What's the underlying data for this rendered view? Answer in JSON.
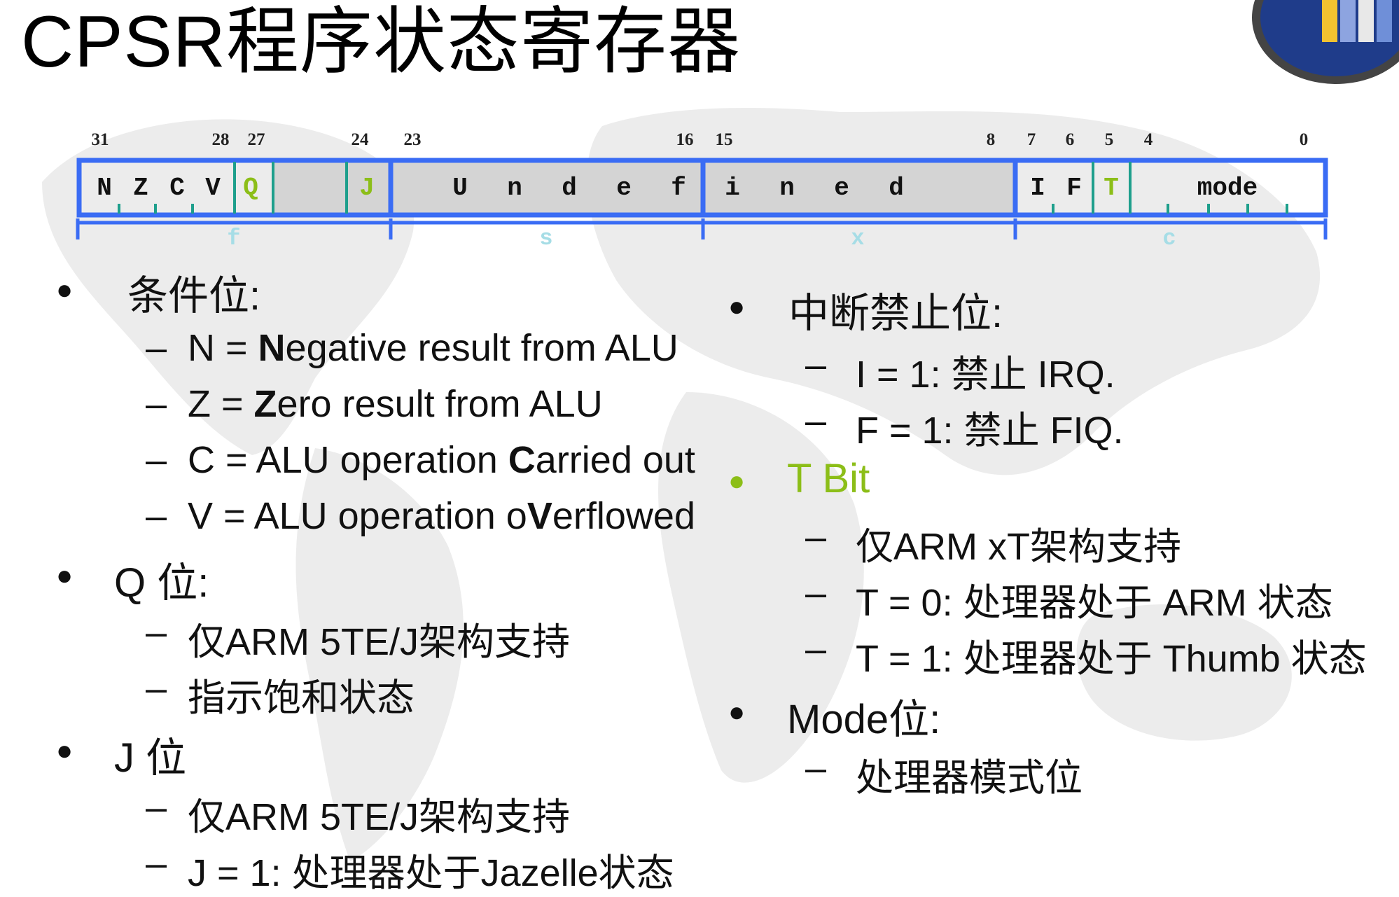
{
  "title": "CPSR程序状态寄存器",
  "register": {
    "bit_numbers": [
      "31",
      "28",
      "27",
      "24",
      "23",
      "16",
      "15",
      "8",
      "7",
      "6",
      "5",
      "4",
      "0"
    ],
    "flags": [
      "N",
      "Z",
      "C",
      "V",
      "Q",
      "J",
      "U",
      "n",
      "d",
      "e",
      "f",
      "i",
      "n",
      "e",
      "d",
      "I",
      "F",
      "T",
      "mode"
    ],
    "fields": [
      "f",
      "s",
      "x",
      "c"
    ]
  },
  "left": {
    "condition": {
      "heading": "条件位:",
      "items": [
        {
          "pre": "N = ",
          "bold": "N",
          "post": "egative result from ALU"
        },
        {
          "pre": "Z = ",
          "bold": "Z",
          "post": "ero result from ALU"
        },
        {
          "pre": "C = ALU operation ",
          "bold": "C",
          "post": "arried out"
        },
        {
          "pre": "V = ALU operation o",
          "bold": "V",
          "post": "erflowed"
        }
      ]
    },
    "q_bit": {
      "heading": "Q 位:",
      "items": [
        "仅ARM 5TE/J架构支持",
        "指示饱和状态"
      ]
    },
    "j_bit": {
      "heading": "J 位",
      "items": [
        "仅ARM 5TE/J架构支持",
        "J = 1:  处理器处于Jazelle状态"
      ]
    }
  },
  "right": {
    "interrupt": {
      "heading": "中断禁止位:",
      "items": [
        "I  = 1: 禁止  IRQ.",
        "F = 1: 禁止  FIQ."
      ]
    },
    "t_bit": {
      "heading": "T Bit",
      "items": [
        "仅ARM  xT架构支持",
        "T = 0: 处理器处于 ARM 状态",
        "T = 1: 处理器处于 Thumb 状态"
      ]
    },
    "mode": {
      "heading": "Mode位:",
      "items": [
        "处理器模式位"
      ]
    }
  },
  "colors": {
    "accent_green": "#8cbe18",
    "register_blue": "#3a6cf4",
    "register_teal": "#1e9f8c",
    "field_label": "#a6dde6"
  }
}
